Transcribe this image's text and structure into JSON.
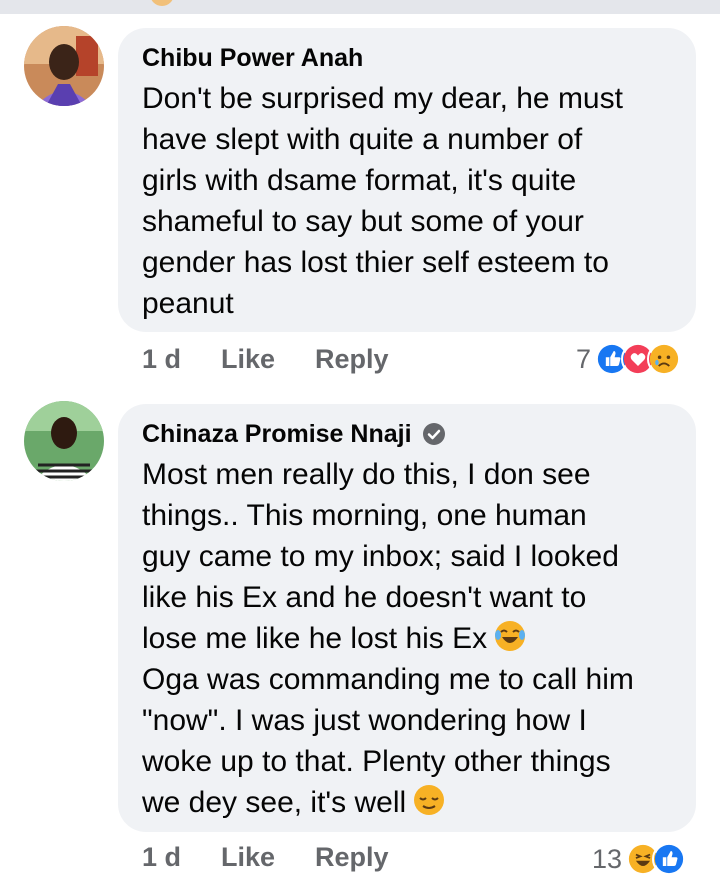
{
  "comments": [
    {
      "author": "Chibu Power Anah",
      "verified": false,
      "lines": [
        "Don't be surprised my dear, he must",
        "have slept with quite a number of",
        "girls with dsame format, it's quite",
        "shameful to say but some of your",
        "gender has lost thier self esteem to",
        "peanut"
      ],
      "time": "1 d",
      "like_label": "Like",
      "reply_label": "Reply",
      "reaction_count": "7",
      "reactions": [
        "like-icon",
        "love-icon",
        "sad-icon"
      ]
    },
    {
      "author": "Chinaza Promise Nnaji",
      "verified": true,
      "lines": [
        "Most men really do this, I don see",
        "things.. This morning, one human",
        "guy came to my inbox; said I looked",
        "like his Ex and he doesn't want to",
        "lose me like he lost his Ex",
        "Oga was commanding me to call him",
        "\"now\". I was just wondering how I",
        "woke up to that.  Plenty other things",
        "we dey see, it's well"
      ],
      "time": "1 d",
      "like_label": "Like",
      "reply_label": "Reply",
      "reaction_count": "13",
      "reactions": [
        "haha-icon",
        "like-icon"
      ]
    }
  ],
  "colors": {
    "bubble": "#f0f2f5",
    "meta_text": "#65676b",
    "like_blue": "#1877f2",
    "love_red": "#f33e58",
    "emoji_yellow": "#f7b125"
  }
}
